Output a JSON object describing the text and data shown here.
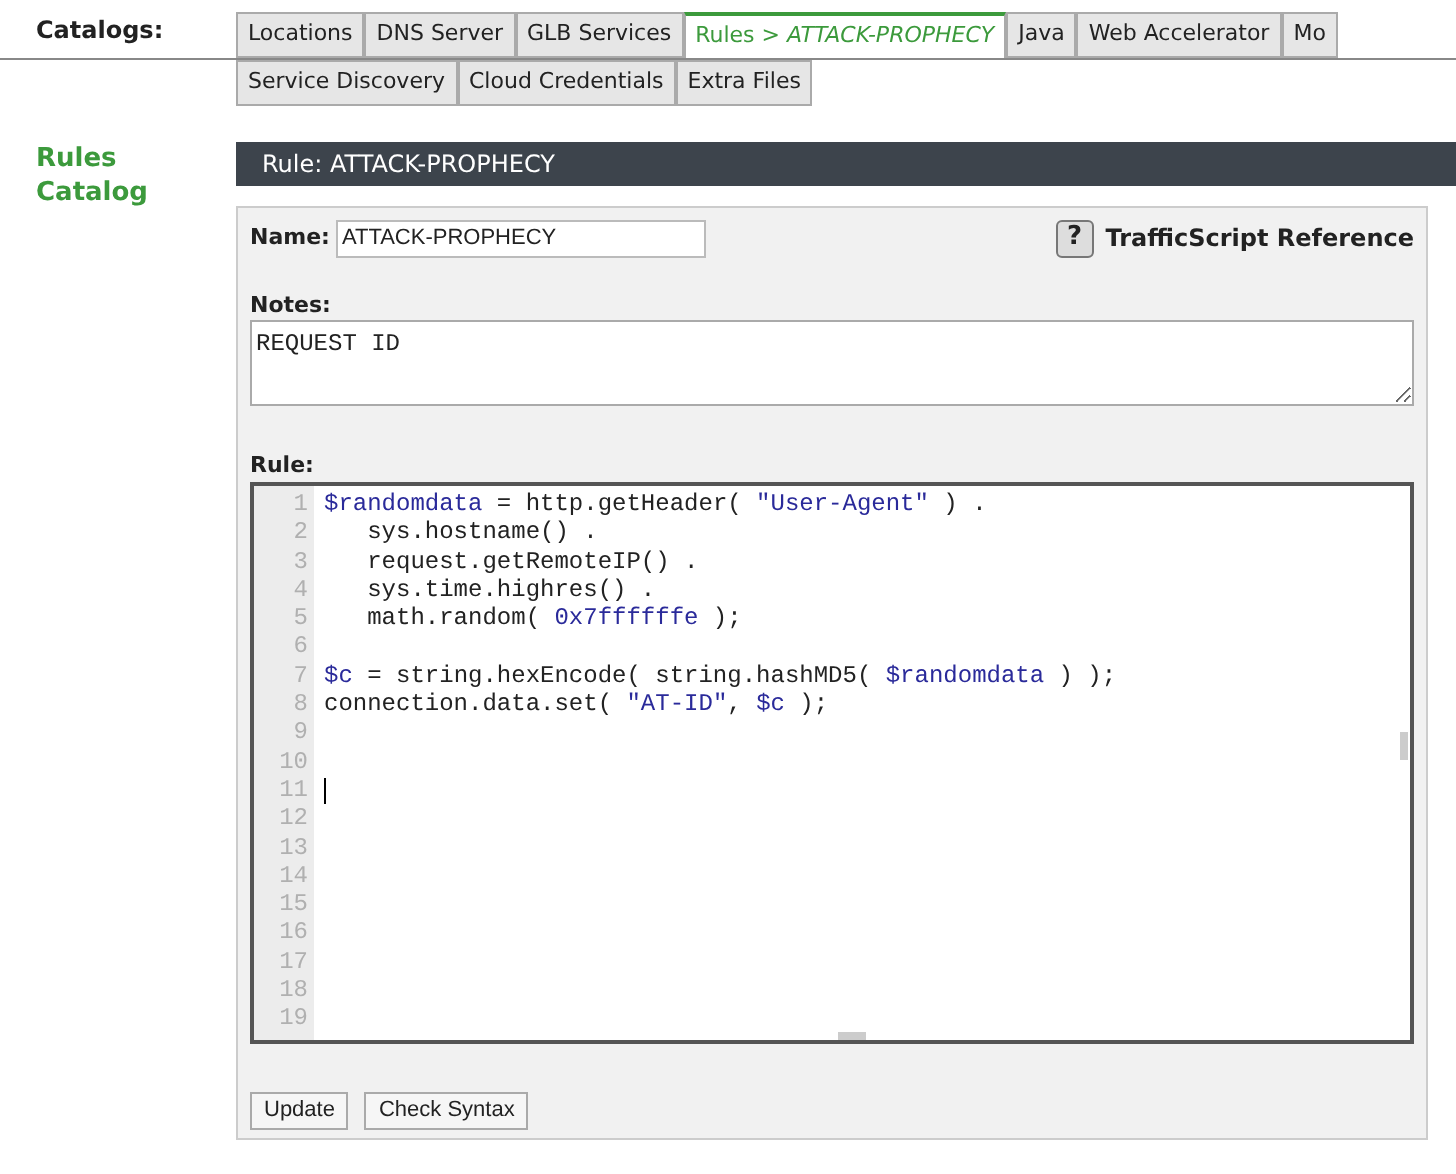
{
  "catalogs_label": "Catalogs:",
  "tab_rows": [
    [
      {
        "label": "Locations",
        "selected": false
      },
      {
        "label": "DNS Server",
        "selected": false
      },
      {
        "label": "GLB Services",
        "selected": false
      },
      {
        "label": "Rules > *ATTACK-PROPHECY*",
        "selected": true
      },
      {
        "label": "Java",
        "selected": false
      },
      {
        "label": "Web Accelerator",
        "selected": false
      },
      {
        "label": "Mo",
        "selected": false
      }
    ],
    [
      {
        "label": "Service Discovery",
        "selected": false
      },
      {
        "label": "Cloud Credentials",
        "selected": false
      },
      {
        "label": "Extra Files",
        "selected": false
      }
    ]
  ],
  "sidebar": {
    "title": "Rules Catalog"
  },
  "panel": {
    "title": "Rule: ATTACK-PROPHECY",
    "name_label": "Name:",
    "name_value": "ATTACK-PROPHECY",
    "help_icon_text": "?",
    "reference_link": "TrafficScript Reference",
    "notes_label": "Notes:",
    "notes_value": "REQUEST ID",
    "rule_label": "Rule:",
    "code_lines": [
      {
        "number": "1",
        "tokens": [
          {
            "kind": "var",
            "text": "$randomdata"
          },
          {
            "kind": "plain",
            "text": " = http.getHeader( "
          },
          {
            "kind": "string",
            "text": "\"User-Agent\""
          },
          {
            "kind": "plain",
            "text": " ) ."
          }
        ]
      },
      {
        "number": "2",
        "tokens": [
          {
            "kind": "plain",
            "text": "   sys.hostname() ."
          }
        ]
      },
      {
        "number": "3",
        "tokens": [
          {
            "kind": "plain",
            "text": "   request.getRemoteIP() ."
          }
        ]
      },
      {
        "number": "4",
        "tokens": [
          {
            "kind": "plain",
            "text": "   sys.time.highres() ."
          }
        ]
      },
      {
        "number": "5",
        "tokens": [
          {
            "kind": "plain",
            "text": "   math.random( "
          },
          {
            "kind": "number",
            "text": "0x7ffffffe"
          },
          {
            "kind": "plain",
            "text": " );"
          }
        ]
      },
      {
        "number": "6"
      },
      {
        "number": "7",
        "tokens": [
          {
            "kind": "var",
            "text": "$c"
          },
          {
            "kind": "plain",
            "text": " = string.hexEncode( string.hashMD5( "
          },
          {
            "kind": "var",
            "text": "$randomdata"
          },
          {
            "kind": "plain",
            "text": " ) );"
          }
        ]
      },
      {
        "number": "8",
        "tokens": [
          {
            "kind": "plain",
            "text": "connection.data.set( "
          },
          {
            "kind": "string",
            "text": "\"AT-ID\""
          },
          {
            "kind": "plain",
            "text": ", "
          },
          {
            "kind": "var",
            "text": "$c"
          },
          {
            "kind": "plain",
            "text": " );"
          }
        ]
      },
      {
        "number": "9"
      },
      {
        "number": "10"
      },
      {
        "number": "11",
        "cursor": true
      },
      {
        "number": "12"
      },
      {
        "number": "13"
      },
      {
        "number": "14"
      },
      {
        "number": "15"
      },
      {
        "number": "16"
      },
      {
        "number": "17"
      },
      {
        "number": "18"
      },
      {
        "number": "19"
      }
    ],
    "buttons": [
      "Update",
      "Check Syntax"
    ]
  }
}
